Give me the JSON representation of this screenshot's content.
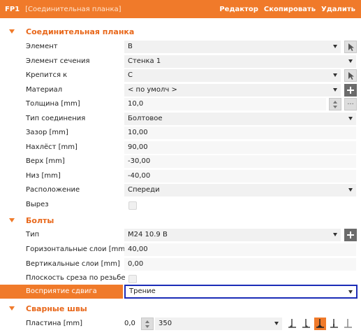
{
  "header": {
    "code": "FP1",
    "title": "[Соединительная планка]",
    "actions": [
      "Редактор",
      "Скопировать",
      "Удалить"
    ]
  },
  "sections": {
    "plate": "Соединительная планка",
    "bolts": "Болты",
    "welds": "Сварные швы"
  },
  "plate_rows": [
    {
      "label": "Элемент",
      "value": "B"
    },
    {
      "label": "Элемент сечения",
      "value": "Стенка 1"
    },
    {
      "label": "Крепится к",
      "value": "C"
    },
    {
      "label": "Материал",
      "value": "< по умолч >"
    },
    {
      "label": "Толщина [mm]",
      "value": "10,0"
    },
    {
      "label": "Тип соединения",
      "value": "Болтовое"
    },
    {
      "label": "Зазор [mm]",
      "value": "10,00"
    },
    {
      "label": "Нахлёст [mm]",
      "value": "90,00"
    },
    {
      "label": "Верх [mm]",
      "value": "-30,00"
    },
    {
      "label": "Низ [mm]",
      "value": "-40,00"
    },
    {
      "label": "Расположение",
      "value": "Спереди"
    },
    {
      "label": "Вырез",
      "value": ""
    }
  ],
  "bolt_rows": [
    {
      "label": "Тип",
      "value": "M24 10.9 B"
    },
    {
      "label": "Горизонтальные слои [mm]",
      "value": "40,00"
    },
    {
      "label": "Вертикальные слои [mm]",
      "value": "0,00"
    },
    {
      "label": "Плоскость среза по резьбе",
      "value": ""
    },
    {
      "label": "Восприятие сдвига",
      "value": "Трение"
    }
  ],
  "weld_rows": [
    {
      "label": "Пластина [mm]",
      "thickness": "0,0",
      "type": "350"
    }
  ],
  "colors": {
    "accent": "#f07a2a",
    "focus": "#1b2cb7"
  }
}
